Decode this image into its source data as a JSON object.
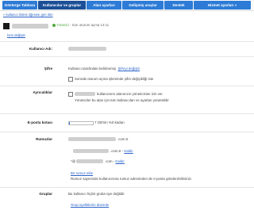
{
  "tabs": [
    {
      "label": "Gösterge Tablosu"
    },
    {
      "label": "Kullanıcılar ve gruplar"
    },
    {
      "label": "Alan ayarları"
    },
    {
      "label": "Gelişmiş araçlar"
    },
    {
      "label": "Destek"
    },
    {
      "label": "Hizmet ayarları »"
    }
  ],
  "breadcrumb": "« kullanıcı listesi öğesine geri dön",
  "status": {
    "role": "Yönetici",
    "last_login": " - Son oturum açma 14:11"
  },
  "rename_link": "İsmi değiştir",
  "fields": {
    "username_label": "Kullanıcı Adı:",
    "password_label": "Şifre",
    "password_desc": "Kullanıcı tarafından belirlenmiş",
    "password_change": "Şifreyi değiştir",
    "password_checkbox": "Sonraki oturum açma işleminde şifre değişikliği iste",
    "privileges_label": "Ayrıcalıklar",
    "privileges_text_1": "kullanıcısını alanınızın yöneticisine izin ver.",
    "privileges_text_2": "Yöneticiler bu alan için tüm kullanıcıları ve ayarları yönetebilir",
    "quota_label": "E-posta kotası",
    "quota_text": "7 GB'nin %0 kadarı",
    "quota_fill_fraction": 0.02,
    "nicknames_label": "Rumuzlar",
    "nick_domain_1": ".com.tr",
    "nick_remove": "Kaldır",
    "nick_domain_2": ".com",
    "add_nickname": "Bir rumuz ekle",
    "nickname_desc": "Rumuz sayesinde kullanıcısına rumuz adresinden de e-posta gönderebilirsiniz.",
    "groups_label": "Gruplar",
    "groups_text": "Bu kullanıcı hiçbir gruba üye değildir.",
    "groups_link": "Grup üyeliklerini düzenle"
  }
}
